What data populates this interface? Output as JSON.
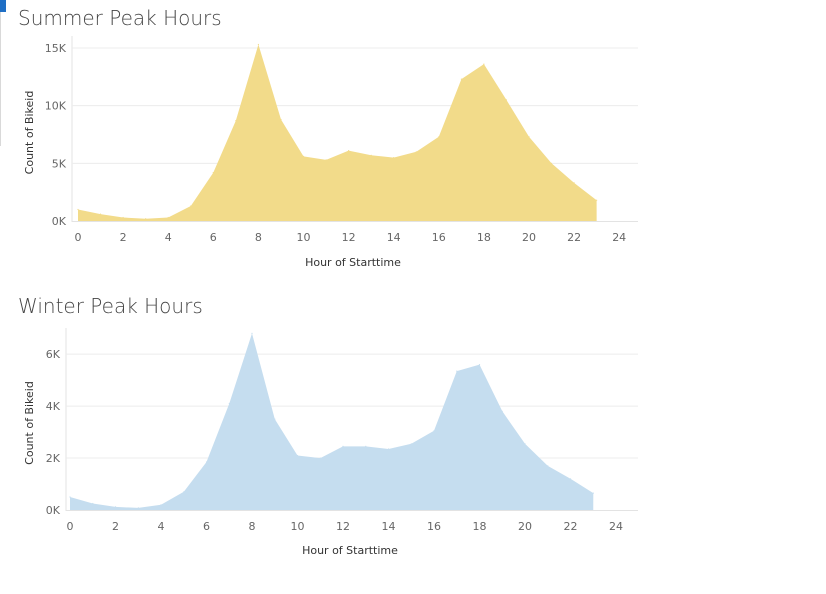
{
  "chart_data": [
    {
      "type": "area",
      "title": "Summer Peak Hours",
      "xlabel": "Hour of Starttime",
      "ylabel": "Count of Bikeid",
      "xlim": [
        0,
        24
      ],
      "ylim": [
        0,
        15000
      ],
      "x_ticks": [
        "0",
        "2",
        "4",
        "6",
        "8",
        "10",
        "12",
        "14",
        "16",
        "18",
        "20",
        "22",
        "24"
      ],
      "y_ticks": [
        "0K",
        "5K",
        "10K",
        "15K"
      ],
      "grid": true,
      "color": "#f2db8a",
      "x": [
        0,
        1,
        2,
        3,
        4,
        5,
        6,
        7,
        8,
        9,
        10,
        11,
        12,
        13,
        14,
        15,
        16,
        17,
        18,
        19,
        20,
        21,
        22,
        23
      ],
      "values": [
        1000,
        600,
        300,
        200,
        300,
        1300,
        4200,
        8700,
        15300,
        8800,
        5600,
        5300,
        6100,
        5700,
        5500,
        6000,
        7300,
        12300,
        13600,
        10500,
        7300,
        5000,
        3300,
        1800
      ]
    },
    {
      "type": "area",
      "title": "Winter Peak Hours",
      "xlabel": "Hour of Starttime",
      "ylabel": "Count of Bikeid",
      "xlim": [
        0,
        24
      ],
      "ylim": [
        0,
        6700
      ],
      "x_ticks": [
        "0",
        "2",
        "4",
        "6",
        "8",
        "10",
        "12",
        "14",
        "16",
        "18",
        "20",
        "22",
        "24"
      ],
      "y_ticks": [
        "0K",
        "2K",
        "4K",
        "6K"
      ],
      "grid": true,
      "color": "#c5ddef",
      "x": [
        0,
        1,
        2,
        3,
        4,
        5,
        6,
        7,
        8,
        9,
        10,
        11,
        12,
        13,
        14,
        15,
        16,
        17,
        18,
        19,
        20,
        21,
        22,
        23
      ],
      "values": [
        500,
        250,
        120,
        80,
        200,
        700,
        1850,
        4100,
        6800,
        3500,
        2100,
        2000,
        2450,
        2450,
        2350,
        2550,
        3050,
        5350,
        5600,
        3800,
        2550,
        1700,
        1200,
        650
      ]
    }
  ]
}
